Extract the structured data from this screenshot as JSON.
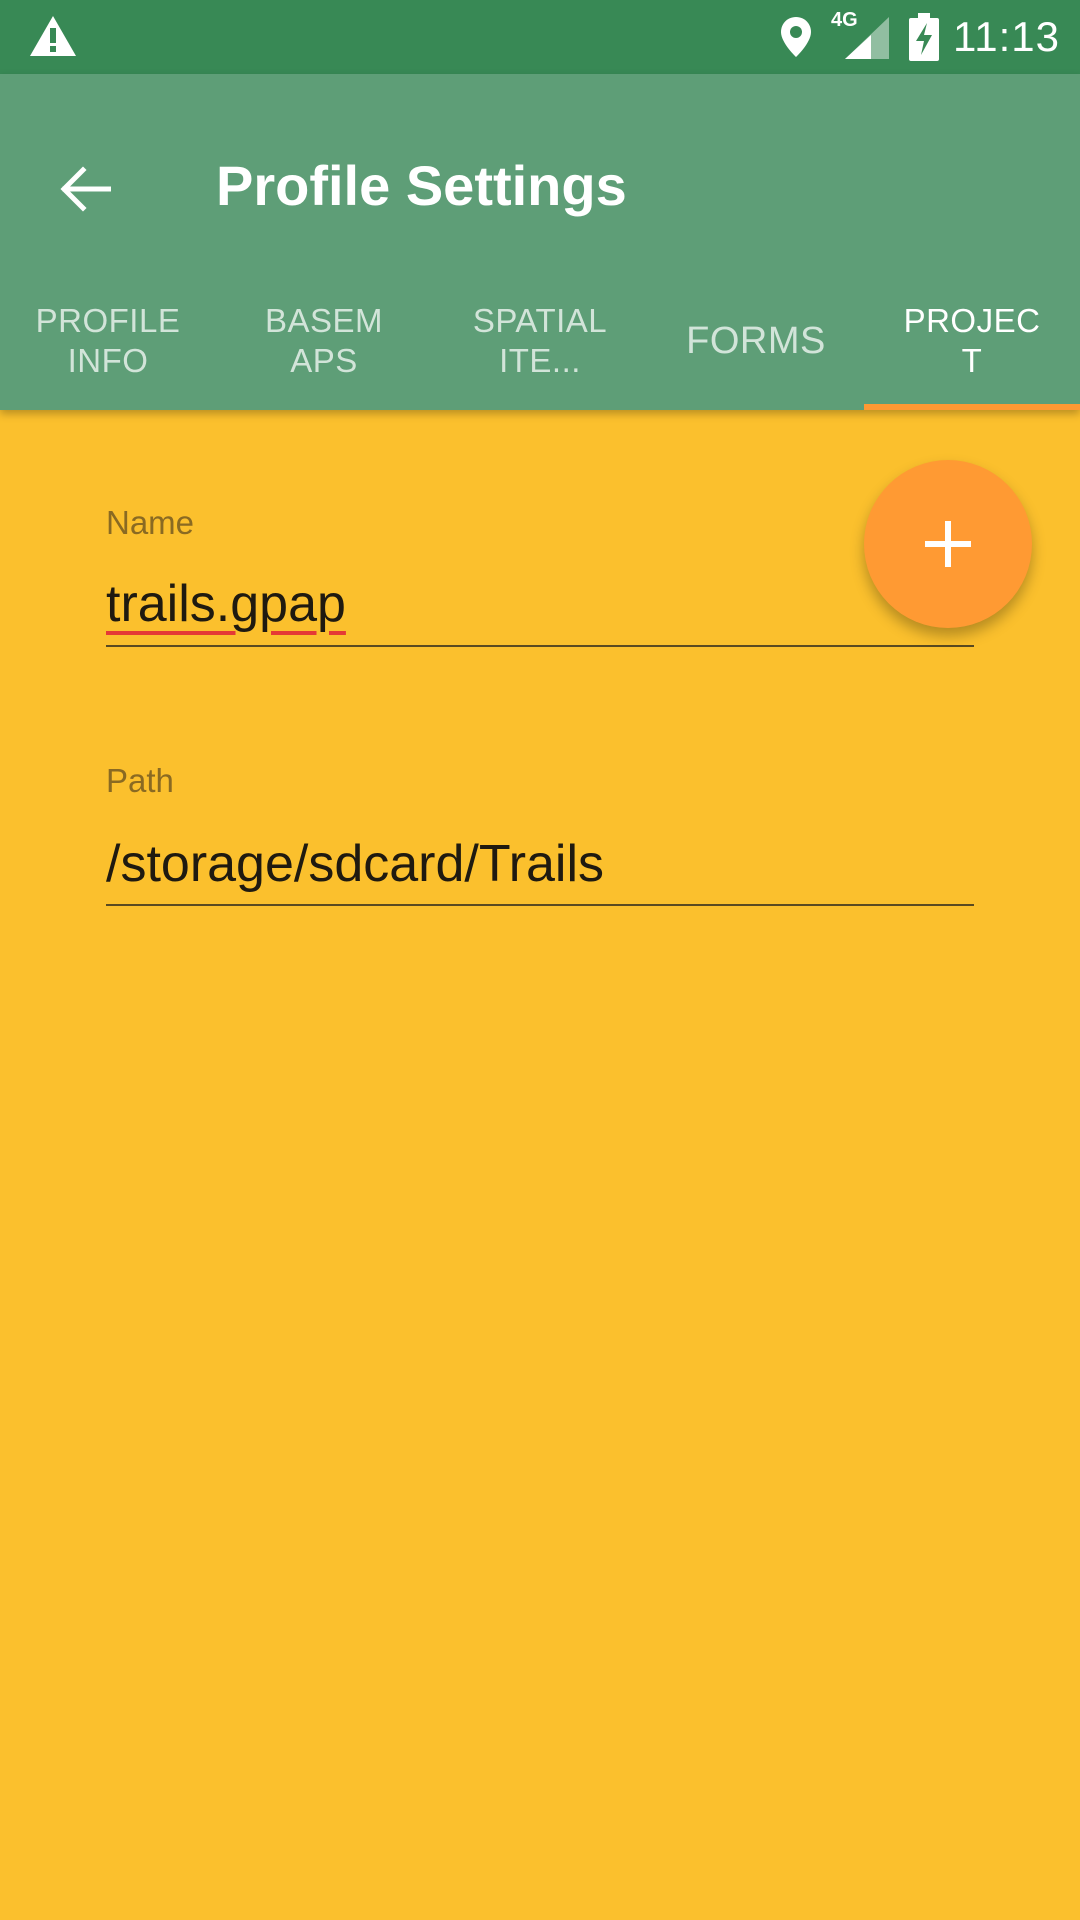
{
  "status_bar": {
    "time": "11:13",
    "network_label": "4G",
    "icons": [
      "warning-icon",
      "location-icon",
      "signal-icon",
      "battery-charging-icon"
    ]
  },
  "app_bar": {
    "title": "Profile Settings",
    "back_icon": "arrow-back-icon"
  },
  "tabs": [
    {
      "label": "PROFILE\nINFO",
      "active": false
    },
    {
      "label": "BASEM\nAPS",
      "active": false
    },
    {
      "label": "SPATIAL\nITE...",
      "active": false
    },
    {
      "label": "FORMS",
      "active": false
    },
    {
      "label": "PROJEC\nT",
      "active": true
    }
  ],
  "form": {
    "name": {
      "label": "Name",
      "value": "trails.gpap"
    },
    "path": {
      "label": "Path",
      "value": "/storage/sdcard/Trails"
    }
  },
  "fab": {
    "icon": "add-icon"
  },
  "colors": {
    "status_bar": "#388955",
    "app_bar": "#5e9e77",
    "background": "#fbc02d",
    "accent": "#ff9a33"
  }
}
